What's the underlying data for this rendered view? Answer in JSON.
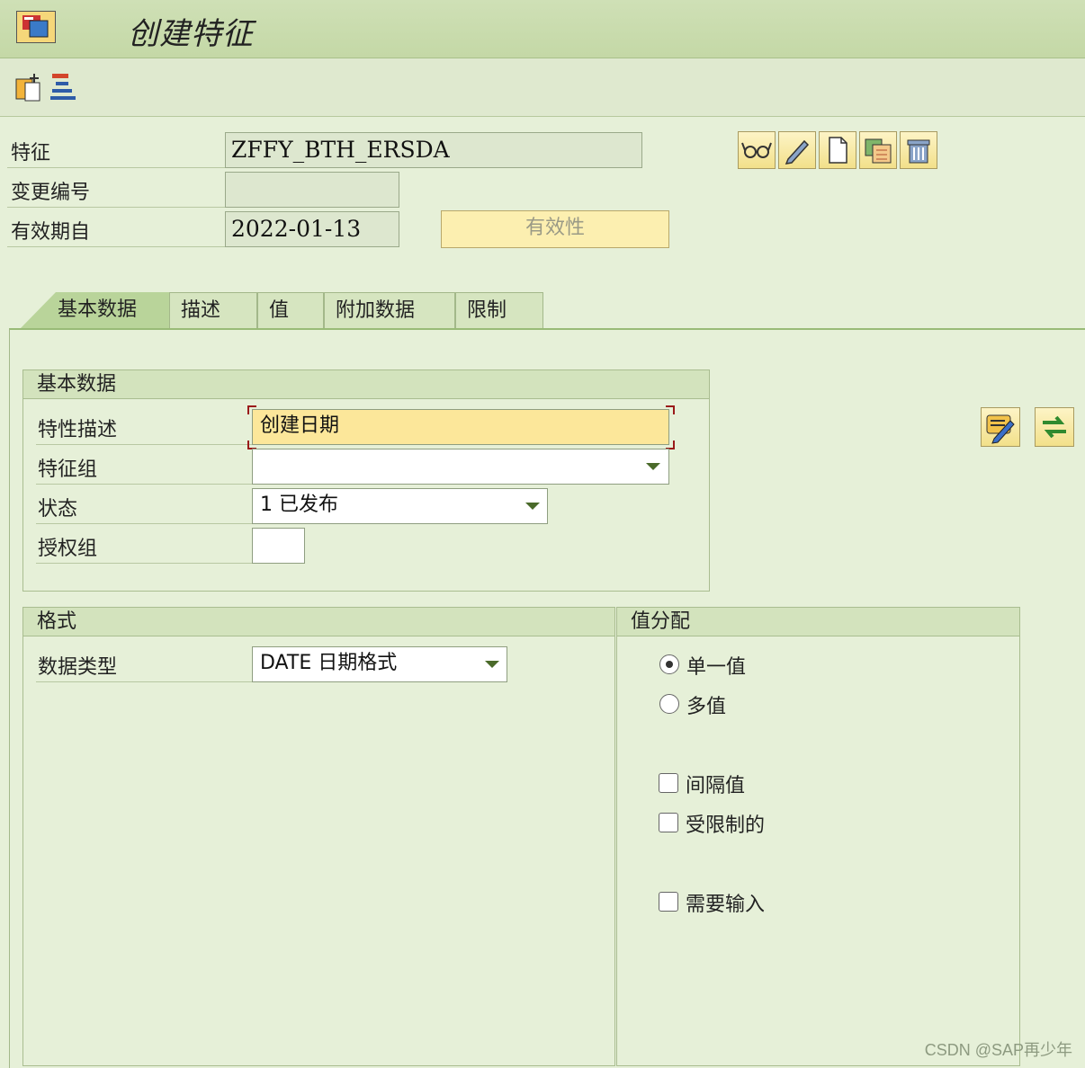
{
  "window": {
    "title": "创建特征"
  },
  "header": {
    "characteristic_label": "特征",
    "characteristic_value": "ZFFY_BTH_ERSDA",
    "change_number_label": "变更编号",
    "change_number_value": "",
    "valid_from_label": "有效期自",
    "valid_from_value": "2022-01-13",
    "validity_button": "有效性"
  },
  "tabs": [
    {
      "label": "基本数据",
      "active": true
    },
    {
      "label": "描述"
    },
    {
      "label": "值"
    },
    {
      "label": "附加数据"
    },
    {
      "label": "限制"
    }
  ],
  "basic_group": {
    "title": "基本数据",
    "description_label": "特性描述",
    "description_value": "创建日期",
    "char_group_label": "特征组",
    "char_group_value": "",
    "status_label": "状态",
    "status_value": "1 已发布",
    "auth_group_label": "授权组",
    "auth_group_value": ""
  },
  "format_group": {
    "title": "格式",
    "data_type_label": "数据类型",
    "data_type_value": "DATE 日期格式"
  },
  "value_group": {
    "title": "值分配",
    "single_value": "单一值",
    "multi_value": "多值",
    "interval_value": "间隔值",
    "restricted": "受限制的",
    "entry_required": "需要输入",
    "selected": "single_value"
  },
  "watermark": "CSDN @SAP再少年",
  "colors": {
    "background": "#e6f0d8",
    "required_field": "#fce79a",
    "button": "#fcefb0"
  }
}
